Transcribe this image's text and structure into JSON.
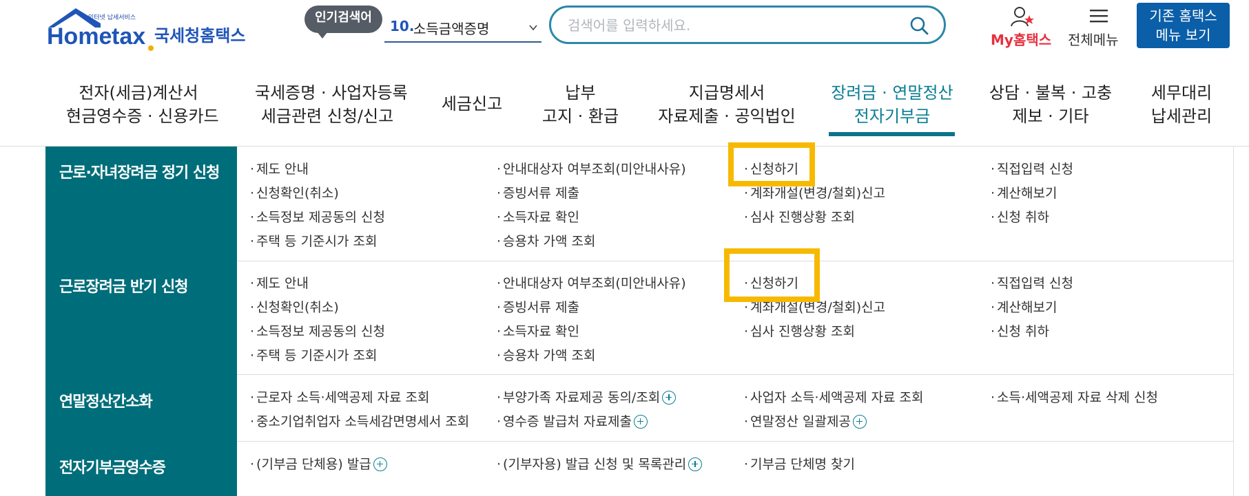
{
  "header": {
    "logo_small": "인터넷 납세서비스",
    "logo_name": "Hometax",
    "logo_ko": "국세청홈택스",
    "popular_badge": "인기검색어",
    "popular_rank": "10.",
    "popular_term": "소득금액증명",
    "search_placeholder": "검색어를 입력하세요.",
    "my_label": "My홈택스",
    "all_menu_label": "전체메뉴",
    "old_home_line1": "기존 홈택스",
    "old_home_line2": "메뉴 보기"
  },
  "gnb": [
    {
      "line1": "전자(세금)계산서",
      "line2": "현금영수증 · 신용카드"
    },
    {
      "line1": "국세증명 · 사업자등록",
      "line2": "세금관련 신청/신고"
    },
    {
      "line1": "세금신고",
      "line2": ""
    },
    {
      "line1": "납부",
      "line2": "고지 · 환급"
    },
    {
      "line1": "지급명세서",
      "line2": "자료제출 · 공익법인"
    },
    {
      "line1": "장려금 · 연말정산",
      "line2": "전자기부금"
    },
    {
      "line1": "상담 · 불복 · 고충",
      "line2": "제보 · 기타"
    },
    {
      "line1": "세무대리",
      "line2": "납세관리"
    }
  ],
  "sections": [
    {
      "title": "근로·자녀장려금 정기 신청",
      "items": [
        "제도 안내",
        "안내대상자 여부조회(미안내사유)",
        "신청하기",
        "직접입력 신청",
        "신청확인(취소)",
        "증빙서류 제출",
        "계좌개설(변경/철회)신고",
        "계산해보기",
        "소득정보 제공동의 신청",
        "소득자료 확인",
        "심사 진행상황 조회",
        "신청 취하",
        "주택 등 기준시가 조회",
        "승용차 가액 조회"
      ]
    },
    {
      "title": "근로장려금 반기 신청",
      "items": [
        "제도 안내",
        "안내대상자 여부조회(미안내사유)",
        "신청하기",
        "직접입력 신청",
        "신청확인(취소)",
        "증빙서류 제출",
        "계좌개설(변경/철회)신고",
        "계산해보기",
        "소득정보 제공동의 신청",
        "소득자료 확인",
        "심사 진행상황 조회",
        "신청 취하",
        "주택 등 기준시가 조회",
        "승용차 가액 조회"
      ]
    },
    {
      "title": "연말정산간소화",
      "items": [
        "근로자 소득·세액공제 자료 조회",
        "부양가족 자료제공 동의/조회",
        "사업자 소득·세액공제 자료 조회",
        "소득·세액공제 자료 삭제 신청",
        "중소기업취업자 소득세감면명세서 조회",
        "영수증 발급처 자료제출",
        "연말정산 일괄제공"
      ]
    },
    {
      "title": "전자기부금영수증",
      "items": [
        "(기부금 단체용) 발급",
        "(기부자용) 발급 신청 및 목록관리",
        "기부금 단체명 찾기"
      ]
    }
  ],
  "colors": {
    "teal_dark": "#006e7a",
    "active": "#0a7d93",
    "highlight": "#f7b900",
    "brand_blue": "#0b5ea8",
    "my_red": "#e8303f"
  }
}
